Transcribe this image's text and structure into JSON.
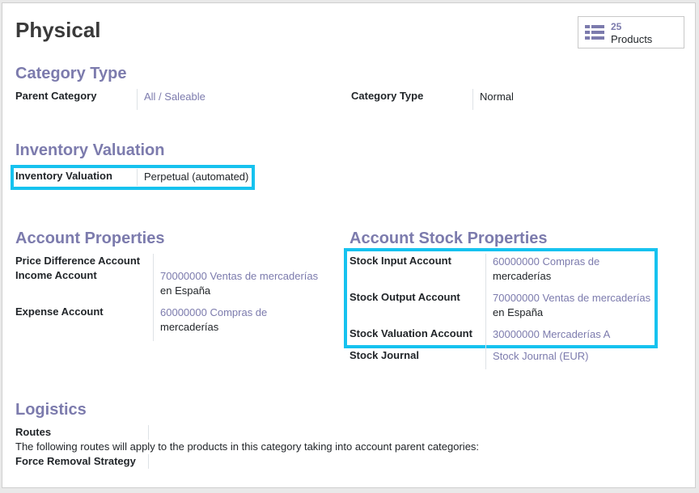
{
  "form": {
    "title": "Physical",
    "smart_button": {
      "count": "25",
      "label": "Products",
      "icon": "list-icon"
    }
  },
  "category_type": {
    "heading": "Category Type",
    "parent_category_label": "Parent Category",
    "parent_category_value": "All / Saleable",
    "category_type_label": "Category Type",
    "category_type_value": "Normal"
  },
  "inventory_valuation": {
    "heading": "Inventory Valuation",
    "label": "Inventory Valuation",
    "value": "Perpetual (automated)"
  },
  "account_properties": {
    "heading": "Account Properties",
    "price_difference_label": "Price Difference Account",
    "income_label": "Income Account",
    "income_value_line1": "70000000 Ventas de mercaderías",
    "income_value_line2": "en España",
    "expense_label": "Expense Account",
    "expense_value_line1": "60000000 Compras de",
    "expense_value_line2": "mercaderías"
  },
  "account_stock_properties": {
    "heading": "Account Stock Properties",
    "stock_input_label": "Stock Input Account",
    "stock_input_value_line1": "60000000 Compras de",
    "stock_input_value_line2": "mercaderías",
    "stock_output_label": "Stock Output Account",
    "stock_output_value_line1": "70000000 Ventas de mercaderías",
    "stock_output_value_line2": "en España",
    "stock_valuation_label": "Stock Valuation Account",
    "stock_valuation_value": "30000000 Mercaderías A",
    "stock_journal_label": "Stock Journal",
    "stock_journal_value": "Stock Journal (EUR)"
  },
  "logistics": {
    "heading": "Logistics",
    "routes_label": "Routes",
    "routes_note": "The following routes will apply to the products in this category taking into account parent categories:",
    "force_removal_label": "Force Removal Strategy"
  },
  "colors": {
    "accent": "#7c7bad",
    "highlight": "#16c2ef"
  }
}
